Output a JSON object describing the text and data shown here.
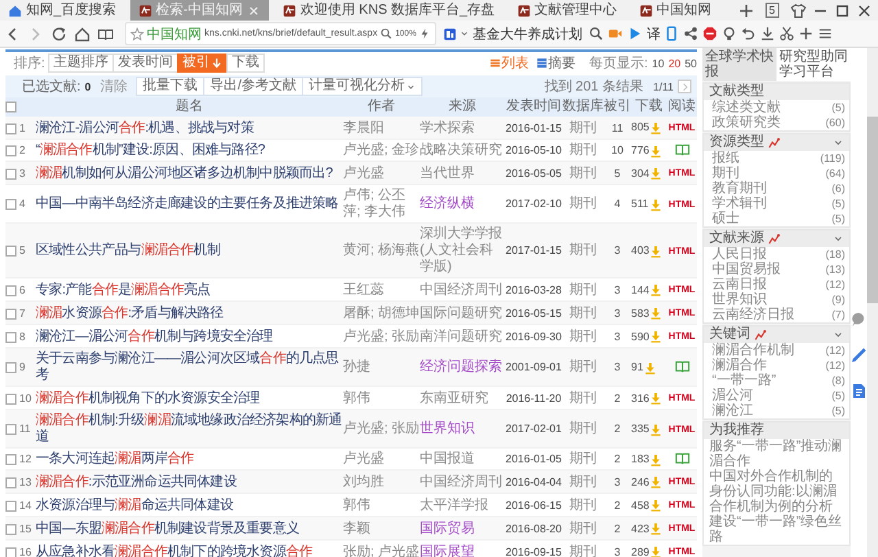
{
  "browser": {
    "tabs": [
      {
        "title": "知网_百度搜索",
        "kind": "home",
        "selected": false
      },
      {
        "title": "检索-中国知网",
        "kind": "logo",
        "selected": true
      },
      {
        "title": "欢迎使用 KNS 数据库平台_存盘",
        "kind": "logo",
        "selected": false
      },
      {
        "title": "文献管理中心",
        "kind": "logo",
        "selected": false
      },
      {
        "title": "中国知网",
        "kind": "logo",
        "selected": false
      }
    ],
    "tab_count": "5",
    "site": "中国知网",
    "url": "kns.cnki.net/kns/brief/default_result.aspx",
    "zoom": "100%",
    "bookmark": "基金大牛养成计划",
    "translate": "译"
  },
  "sort_bar": {
    "label": "排序:",
    "options": [
      {
        "label": "主题排序",
        "selected": false
      },
      {
        "label": "发表时间",
        "selected": false
      },
      {
        "label": "被引",
        "selected": true
      },
      {
        "label": "下载",
        "selected": false
      }
    ],
    "views": [
      {
        "label": "列表",
        "kind": "list",
        "selected": true
      },
      {
        "label": "摘要",
        "kind": "grid",
        "selected": false
      }
    ],
    "page_size_label": "每页显示:",
    "page_sizes": [
      {
        "label": "10",
        "selected": false
      },
      {
        "label": "20",
        "selected": true
      },
      {
        "label": "50",
        "selected": false
      }
    ]
  },
  "toolbar": {
    "selected_label": "已选文献:",
    "selected_count": "0",
    "clear": "清除",
    "actions": [
      "批量下载",
      "导出/参考文献",
      "计量可视化分析"
    ],
    "result_count": "找到 201 条结果",
    "page": "1/11"
  },
  "table": {
    "header_checked": false,
    "columns": [
      "题名",
      "作者",
      "来源",
      "发表时间",
      "数据库",
      "被引",
      "下载",
      "阅读"
    ],
    "rows": [
      {
        "number": "1",
        "checked": false,
        "title": "澜沧江-湄公河**合作**:机遇、挑战与对策",
        "authors": "李晨阳",
        "source": "学术探索",
        "visited": false,
        "date": "2016-01-15",
        "database": "期刊",
        "cited": "11",
        "downloads": "805",
        "read": {
          "kind": "html",
          "label": "HTML"
        }
      },
      {
        "number": "2",
        "checked": false,
        "title": "“**澜湄合作**机制”建设:原因、困难与路径?",
        "authors": "卢光盛; 金珍",
        "source": "战略决策研究",
        "visited": false,
        "date": "2016-05-10",
        "database": "期刊",
        "cited": "10",
        "downloads": "776",
        "read": {
          "kind": "book"
        }
      },
      {
        "number": "3",
        "checked": false,
        "title": "**澜湄**机制如何从湄公河地区诸多边机制中脱颖而出?",
        "authors": "卢光盛",
        "source": "当代世界",
        "visited": false,
        "date": "2016-05-05",
        "database": "期刊",
        "cited": "5",
        "downloads": "304",
        "read": {
          "kind": "html",
          "label": "HTML"
        }
      },
      {
        "number": "4",
        "checked": false,
        "title": "中国—中南半岛经济走廊建设的主要任务及推进策略",
        "authors": "卢伟; 公丕萍; 李大伟",
        "source": "经济纵横",
        "visited": true,
        "date": "2017-02-10",
        "database": "期刊",
        "cited": "4",
        "downloads": "511",
        "read": {
          "kind": "html",
          "label": "HTML"
        }
      },
      {
        "number": "5",
        "checked": false,
        "title": "区域性公共产品与**澜湄合作**机制",
        "authors": "黄河; 杨海燕",
        "source": "深圳大学学报(人文社会科学版)",
        "visited": false,
        "date": "2017-01-15",
        "database": "期刊",
        "cited": "3",
        "downloads": "403",
        "read": {
          "kind": "html",
          "label": "HTML"
        }
      },
      {
        "number": "6",
        "checked": false,
        "title": "专家:产能**合作**是**澜湄合作**亮点",
        "authors": "王红蕊",
        "source": "中国经济周刊",
        "visited": false,
        "date": "2016-03-28",
        "database": "期刊",
        "cited": "3",
        "downloads": "144",
        "read": {
          "kind": "html",
          "label": "HTML"
        }
      },
      {
        "number": "7",
        "checked": false,
        "title": "**澜湄**水资源**合作**:矛盾与解决路径",
        "authors": "屠酥; 胡德坤",
        "source": "国际问题研究",
        "visited": false,
        "date": "2016-05-15",
        "database": "期刊",
        "cited": "3",
        "downloads": "583",
        "read": {
          "kind": "html",
          "label": "HTML"
        }
      },
      {
        "number": "8",
        "checked": false,
        "title": "澜沧江—湄公河**合作**机制与跨境安全治理",
        "authors": "卢光盛; 张励",
        "source": "南洋问题研究",
        "visited": false,
        "date": "2016-09-30",
        "database": "期刊",
        "cited": "3",
        "downloads": "590",
        "read": {
          "kind": "html",
          "label": "HTML"
        }
      },
      {
        "number": "9",
        "checked": false,
        "title": "关于云南参与澜沧江——湄公河次区域**合作**的几点思考",
        "authors": "孙捷",
        "source": "经济问题探索",
        "visited": true,
        "date": "2001-09-01",
        "database": "期刊",
        "cited": "3",
        "downloads": "91",
        "read": {
          "kind": "book"
        }
      },
      {
        "number": "10",
        "checked": false,
        "title": "**澜湄合作**机制视角下的水资源安全治理",
        "authors": "郭伟",
        "source": "东南亚研究",
        "visited": false,
        "date": "2016-11-20",
        "database": "期刊",
        "cited": "2",
        "downloads": "316",
        "read": {
          "kind": "html",
          "label": "HTML"
        }
      },
      {
        "number": "11",
        "checked": false,
        "title": "**澜湄合作**机制:升级**澜湄**流域地缘政治经济架构的新通道",
        "authors": "卢光盛; 张励",
        "source": "世界知识",
        "visited": true,
        "date": "2017-02-01",
        "database": "期刊",
        "cited": "2",
        "downloads": "335",
        "read": {
          "kind": "html",
          "label": "HTML"
        }
      },
      {
        "number": "12",
        "checked": false,
        "title": "一条大河连起**澜湄**两岸**合作**",
        "authors": "卢光盛",
        "source": "中国报道",
        "visited": false,
        "date": "2016-01-05",
        "database": "期刊",
        "cited": "2",
        "downloads": "183",
        "read": {
          "kind": "book"
        }
      },
      {
        "number": "13",
        "checked": false,
        "title": "**澜湄合作**:示范亚洲命运共同体建设",
        "authors": "刘均胜",
        "source": "中国经济周刊",
        "visited": false,
        "date": "2016-04-04",
        "database": "期刊",
        "cited": "3",
        "downloads": "246",
        "read": {
          "kind": "html",
          "label": "HTML"
        }
      },
      {
        "number": "14",
        "checked": false,
        "title": "水资源治理与**澜湄**命运共同体建设",
        "authors": "郭伟",
        "source": "太平洋学报",
        "visited": false,
        "date": "2016-06-15",
        "database": "期刊",
        "cited": "2",
        "downloads": "458",
        "read": {
          "kind": "html",
          "label": "HTML"
        }
      },
      {
        "number": "15",
        "checked": false,
        "title": "中国—东盟**澜湄合作**机制建设背景及重要意义",
        "authors": "李颖",
        "source": "国际贸易",
        "visited": true,
        "date": "2016-08-20",
        "database": "期刊",
        "cited": "2",
        "downloads": "423",
        "read": {
          "kind": "html",
          "label": "HTML"
        }
      },
      {
        "number": "16",
        "checked": false,
        "title": "从应急补水看**澜湄合作**机制下的跨境水资源**合作**",
        "authors": "张励; 卢光盛",
        "source": "国际展望",
        "visited": true,
        "date": "2016-09-15",
        "database": "期刊",
        "cited": "3",
        "downloads": "289",
        "read": {
          "kind": "html",
          "label": "HTML"
        }
      }
    ]
  },
  "sidebar": {
    "promos": [
      "全球学术快报",
      "研究型助同学习平台"
    ],
    "groups": [
      {
        "title": "文献类型",
        "analysis": false,
        "items": [
          {
            "label": "综述类文献",
            "count": "(5)"
          },
          {
            "label": "政策研究类",
            "count": "(60)"
          }
        ]
      },
      {
        "title": "资源类型",
        "analysis": true,
        "items": [
          {
            "label": "报纸",
            "count": "(119)"
          },
          {
            "label": "期刊",
            "count": "(64)"
          },
          {
            "label": "教育期刊",
            "count": "(6)"
          },
          {
            "label": "学术辑刊",
            "count": "(5)"
          },
          {
            "label": "硕士",
            "count": "(5)"
          }
        ]
      },
      {
        "title": "文献来源",
        "analysis": true,
        "items": [
          {
            "label": "人民日报",
            "count": "(18)"
          },
          {
            "label": "中国贸易报",
            "count": "(13)"
          },
          {
            "label": "云南日报",
            "count": "(12)"
          },
          {
            "label": "世界知识",
            "count": "(9)"
          },
          {
            "label": "云南经济日报",
            "count": "(7)"
          }
        ]
      },
      {
        "title": "关键词",
        "analysis": true,
        "items": [
          {
            "label": "澜湄合作机制",
            "count": "(12)"
          },
          {
            "label": "澜湄合作",
            "count": "(12)"
          },
          {
            "label": "“一带一路”",
            "count": "(8)"
          },
          {
            "label": "湄公河",
            "count": "(5)"
          },
          {
            "label": "澜沧江",
            "count": "(5)"
          }
        ]
      }
    ],
    "recommend": {
      "title": "为我推荐",
      "items": [
        "服务“一带一路”推动澜湄合作",
        "中国对外合作机制的身份认同功能:以澜湄合作机制为例的分析",
        "建设“一带一路”绿色丝路"
      ]
    }
  }
}
